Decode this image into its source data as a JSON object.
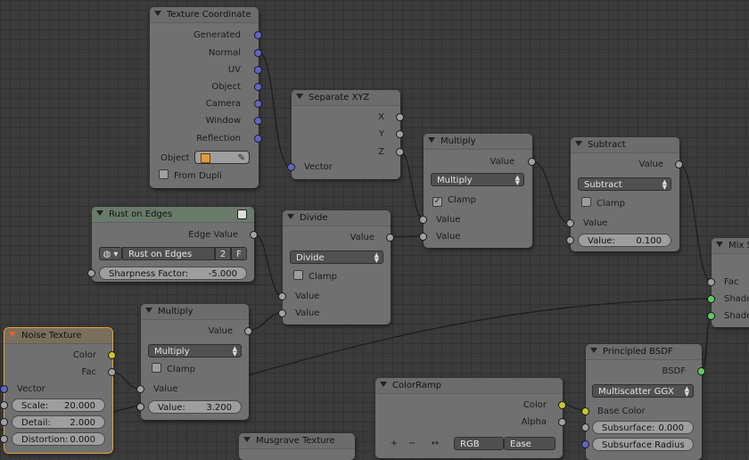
{
  "texture_coordinate": {
    "title": "Texture Coordinate",
    "outputs": [
      "Generated",
      "Normal",
      "UV",
      "Object",
      "Camera",
      "Window",
      "Reflection"
    ],
    "object_label": "Object",
    "from_dupli": "From Dupli"
  },
  "separate_xyz": {
    "title": "Separate XYZ",
    "outputs": [
      "X",
      "Y",
      "Z"
    ],
    "input": "Vector"
  },
  "multiply_top": {
    "title": "Multiply",
    "output": "Value",
    "operation": "Multiply",
    "clamp": "Clamp",
    "input1": "Value",
    "input2": "Value"
  },
  "subtract": {
    "title": "Subtract",
    "output": "Value",
    "operation": "Subtract",
    "clamp": "Clamp",
    "input1": "Value",
    "value_label": "Value:",
    "value": "0.100"
  },
  "mix_shader": {
    "title": "Mix S",
    "fac": "Fac",
    "shader1": "Shade",
    "shader2": "Shade"
  },
  "rust_on_edges": {
    "title": "Rust on Edges",
    "output": "Edge Value",
    "group_name": "Rust on Edges",
    "users": "2",
    "fake_user": "F",
    "sharpness_label": "Sharpness Factor:",
    "sharpness_value": "-5.000"
  },
  "divide": {
    "title": "Divide",
    "output": "Value",
    "operation": "Divide",
    "clamp": "Clamp",
    "input1": "Value",
    "input2": "Value"
  },
  "multiply_mid": {
    "title": "Multiply",
    "output": "Value",
    "operation": "Multiply",
    "clamp": "Clamp",
    "input1": "Value",
    "value_label": "Value:",
    "value": "3.200"
  },
  "noise_texture": {
    "title": "Noise Texture",
    "out_color": "Color",
    "out_fac": "Fac",
    "input_vector": "Vector",
    "scale_label": "Scale:",
    "scale_value": "20.000",
    "detail_label": "Detail:",
    "detail_value": "2.000",
    "distortion_label": "Distortion:",
    "distortion_value": "0.000"
  },
  "principled_bsdf": {
    "title": "Principled BSDF",
    "output": "BSDF",
    "distribution": "Multiscatter GGX",
    "base_color": "Base Color",
    "subsurface_label": "Subsurface:",
    "subsurface_value": "0.000",
    "subsurface_radius": "Subsurface Radius"
  },
  "color_ramp": {
    "title": "ColorRamp",
    "out_color": "Color",
    "out_alpha": "Alpha",
    "add": "+",
    "remove": "−",
    "flip": "↔",
    "mode": "RGB",
    "interpolation": "Ease"
  },
  "musgrave": {
    "title": "Musgrave Texture"
  }
}
